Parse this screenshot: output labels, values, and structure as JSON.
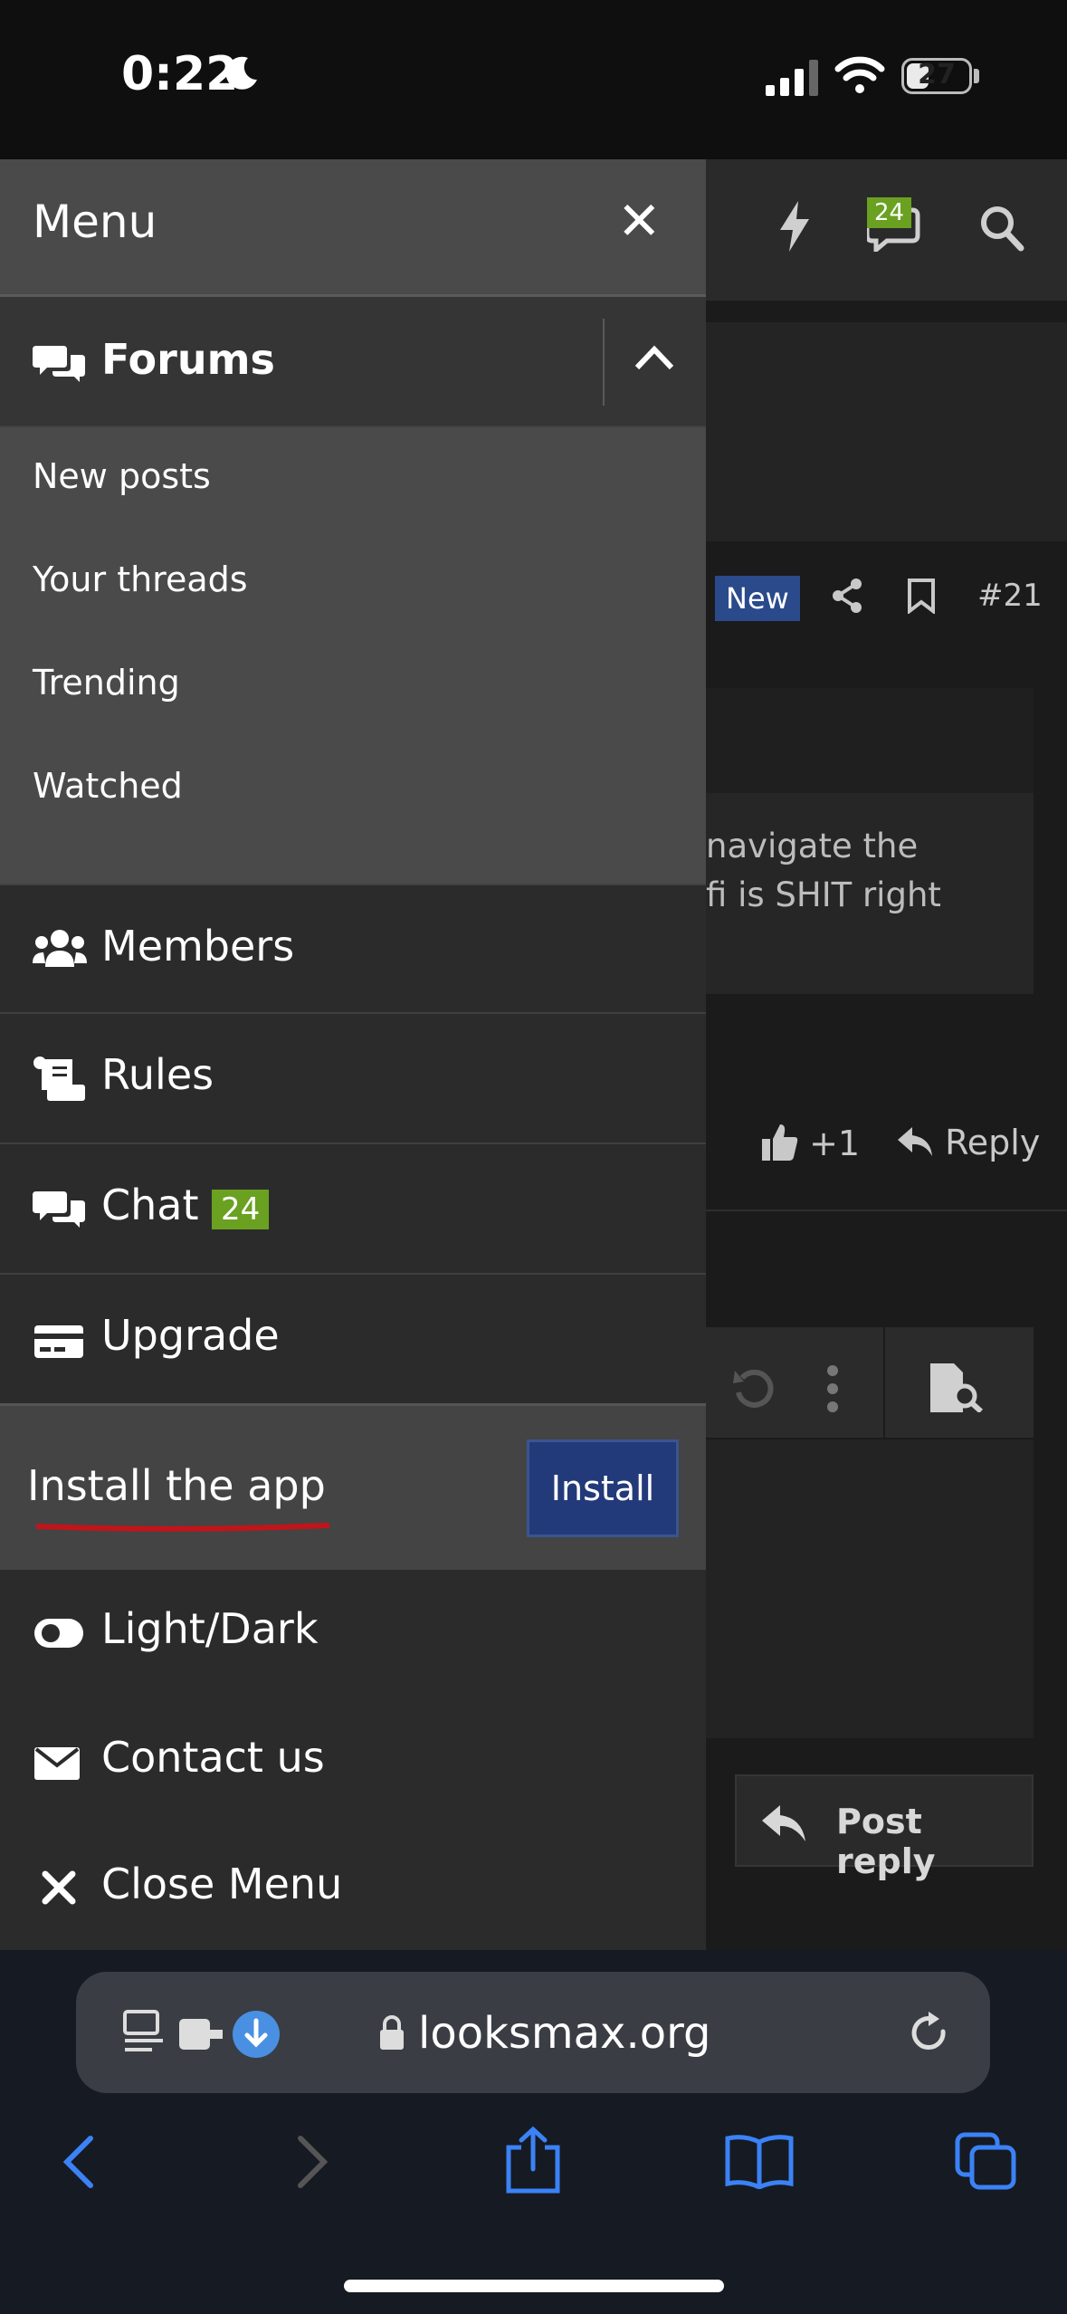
{
  "status": {
    "time": "0:22",
    "battery": "27"
  },
  "background": {
    "chat_badge": "24",
    "new_tag": "New",
    "post_number": "#21",
    "post_text_line1": "navigate the",
    "post_text_line2": "fi is SHIT right",
    "like_count": "+1",
    "reply_label": "Reply",
    "post_reply_label": "Post reply"
  },
  "menu": {
    "title": "Menu",
    "forums_label": "Forums",
    "sub_items": [
      "New posts",
      "Your threads",
      "Trending",
      "Watched"
    ],
    "members_label": "Members",
    "rules_label": "Rules",
    "chat_label": "Chat",
    "chat_badge": "24",
    "upgrade_label": "Upgrade",
    "install_label": "Install the app",
    "install_button": "Install",
    "lightdark_label": "Light/Dark",
    "contact_label": "Contact us",
    "close_label": "Close Menu"
  },
  "browser": {
    "url": "looksmax.org"
  },
  "colors": {
    "accent_blue": "#3b82f6",
    "badge_green": "#6aa121",
    "install_blue": "#233a7a",
    "annotation_red": "#c0151b"
  }
}
